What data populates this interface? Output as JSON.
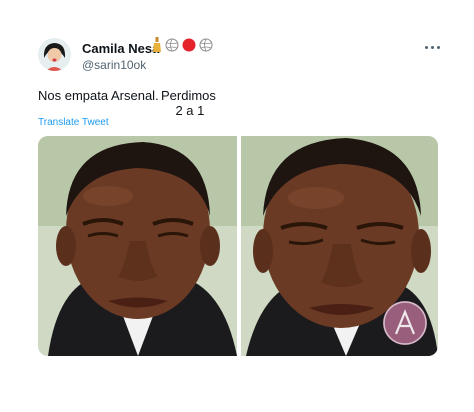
{
  "tweet": {
    "author": {
      "name": "Camila Nesa",
      "handle": "@sarin10ok",
      "name_emojis": [
        "champagne-bottle-icon",
        "volleyball-icon",
        "red-circle-icon",
        "volleyball-icon"
      ]
    },
    "text_main": "Nos empata Arsenal.",
    "text_continuation": "Perdimos\n    2 a 1",
    "translate_label": "Translate Tweet",
    "media": {
      "panels": 2,
      "watermark_letter": "A",
      "watermark_color": "#ff9ac8"
    }
  },
  "colors": {
    "accent": "#1d9bf0",
    "text": "#0f1419",
    "secondary": "#536471"
  }
}
